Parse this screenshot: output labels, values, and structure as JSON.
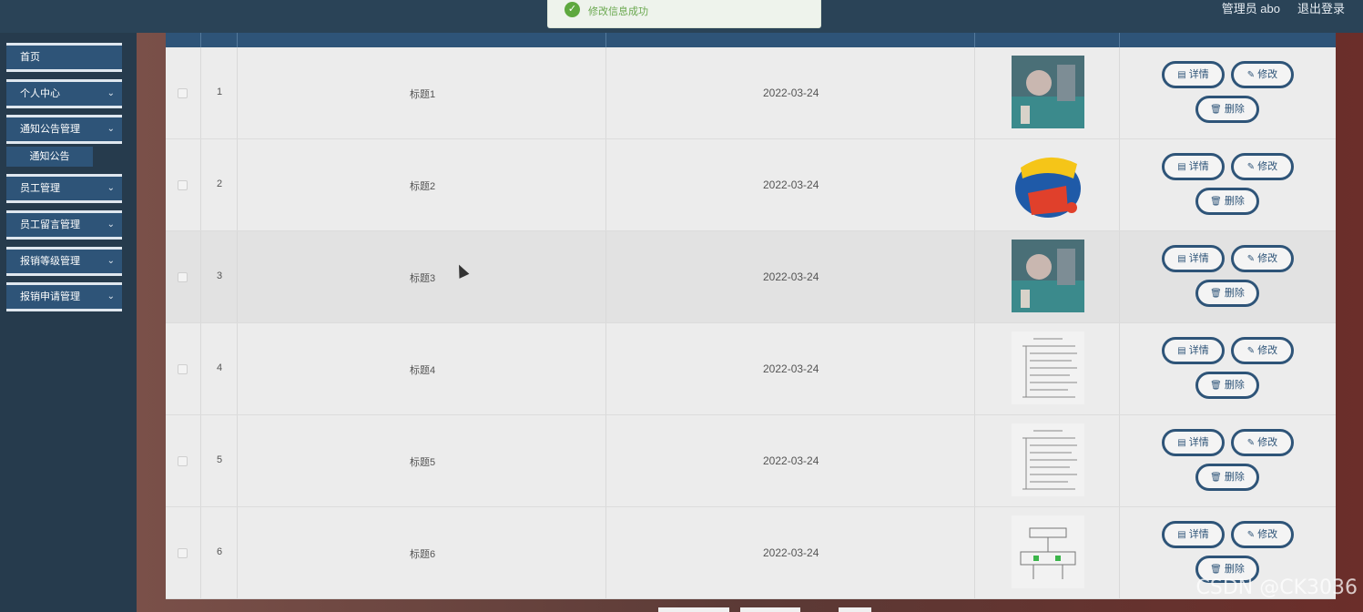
{
  "header": {
    "admin_label": "管理员 abo",
    "logout_label": "退出登录"
  },
  "toast": {
    "message": "修改信息成功"
  },
  "sidebar": {
    "items": [
      {
        "label": "首页",
        "chevron": false
      },
      {
        "label": "个人中心",
        "chevron": true
      },
      {
        "label": "通知公告管理",
        "chevron": true
      },
      {
        "label": "员工管理",
        "chevron": true
      },
      {
        "label": "员工留言管理",
        "chevron": true
      },
      {
        "label": "报销等级管理",
        "chevron": true
      },
      {
        "label": "报销申请管理",
        "chevron": true
      }
    ],
    "sub_item": "通知公告"
  },
  "table": {
    "rows": [
      {
        "index": "1",
        "title": "标题1",
        "date": "2022-03-24",
        "image": "classroom-photo"
      },
      {
        "index": "2",
        "title": "标题2",
        "date": "2022-03-24",
        "image": "english-is-fun-logo"
      },
      {
        "index": "3",
        "title": "标题3",
        "date": "2022-03-24",
        "image": "classroom-photo"
      },
      {
        "index": "4",
        "title": "标题4",
        "date": "2022-03-24",
        "image": "document-scan"
      },
      {
        "index": "5",
        "title": "标题5",
        "date": "2022-03-24",
        "image": "document-scan"
      },
      {
        "index": "6",
        "title": "标题6",
        "date": "2022-03-24",
        "image": "diagram-scan"
      }
    ],
    "actions": {
      "detail": "详情",
      "edit": "修改",
      "delete": "删除"
    },
    "highlighted_row": 3
  },
  "watermark": "CSDN @CK3036",
  "colors": {
    "primary": "#2e5478",
    "sidebar_bg": "#263b4d",
    "topbar_bg": "#2a4357",
    "success": "#5ea83f"
  }
}
